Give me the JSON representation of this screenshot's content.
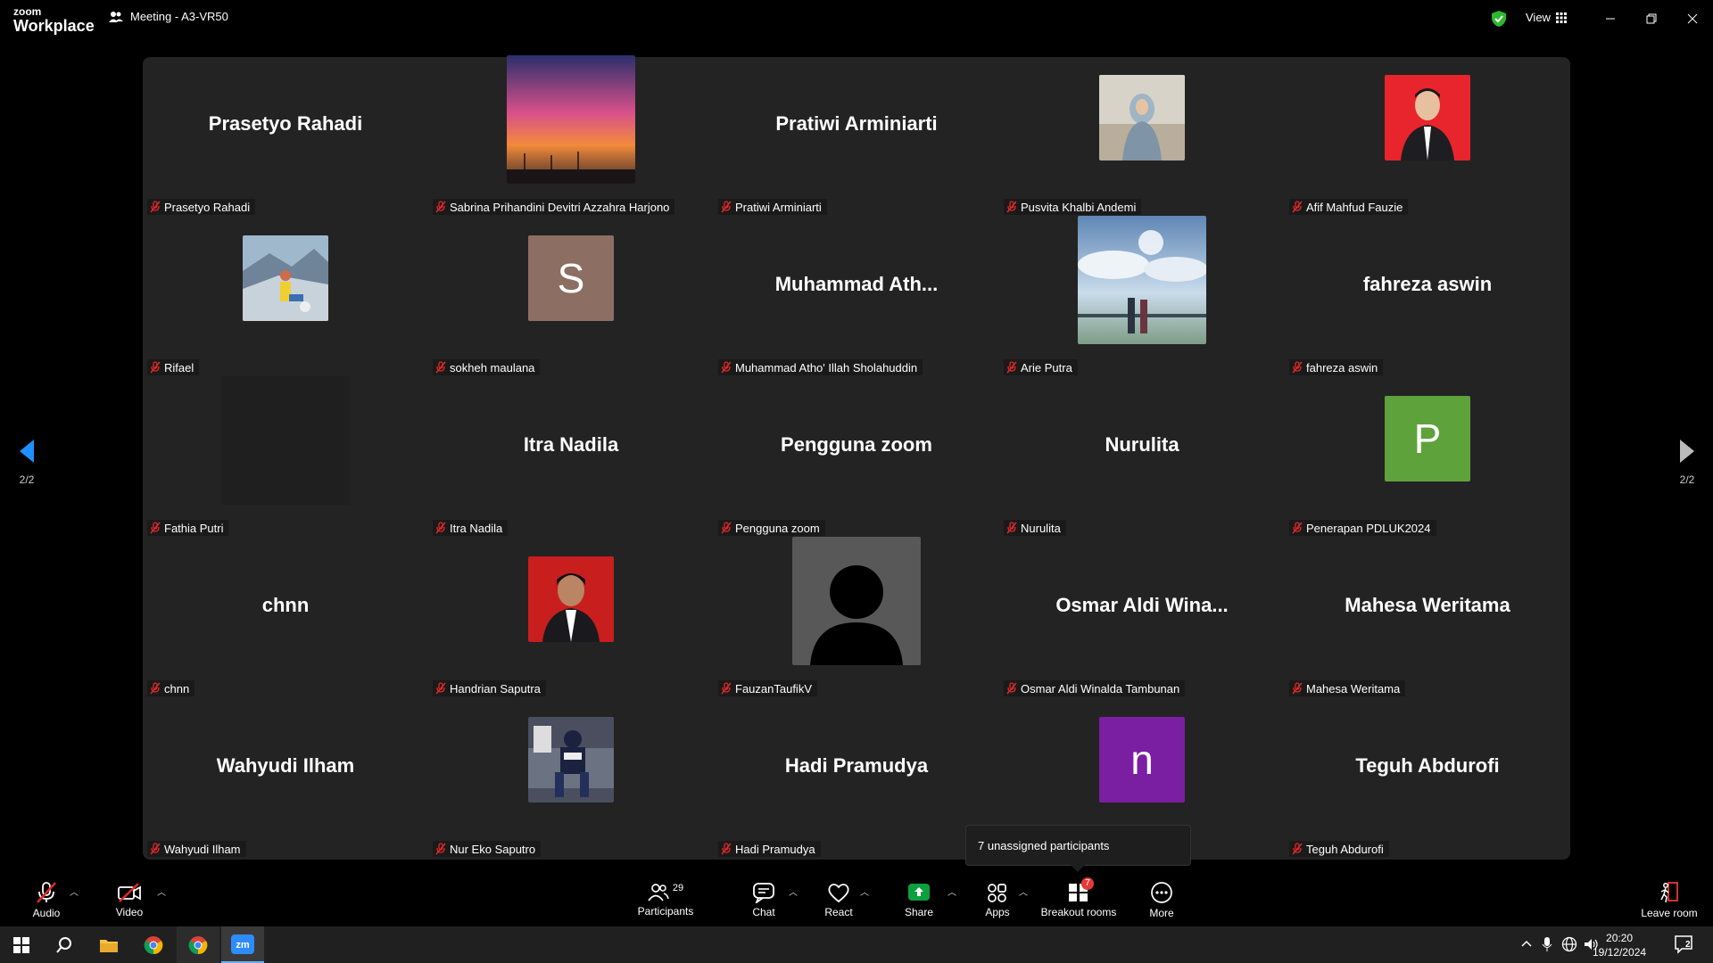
{
  "app": {
    "brand_top": "zoom",
    "brand_bottom": "Workplace",
    "meeting_title": "Meeting - A3-VR50",
    "view_label": "View"
  },
  "navigation": {
    "left_page": "2/2",
    "right_page": "2/2"
  },
  "participants_grid": [
    {
      "tile": "Prasetyo Rahadi",
      "caption": "Prasetyo Rahadi",
      "kind": "name"
    },
    {
      "tile": "",
      "caption": "Sabrina Prihandini Devitri Azzahra Harjono",
      "kind": "photo-sunset"
    },
    {
      "tile": "Pratiwi Arminiarti",
      "caption": "Pratiwi Arminiarti",
      "kind": "name"
    },
    {
      "tile": "",
      "caption": "Pusvita Khalbi Andemi",
      "kind": "photo-hijab"
    },
    {
      "tile": "",
      "caption": "Afif Mahfud Fauzie",
      "kind": "photo-red-formal"
    },
    {
      "tile": "",
      "caption": "Rifael",
      "kind": "photo-mountain"
    },
    {
      "tile": "S",
      "caption": "sokheh maulana",
      "kind": "letter",
      "color": "#8d6e63"
    },
    {
      "tile": "Muhammad  Ath...",
      "caption": "Muhammad Atho' Illah Sholahuddin",
      "kind": "name"
    },
    {
      "tile": "",
      "caption": "Arie Putra",
      "kind": "photo-sky"
    },
    {
      "tile": "fahreza aswin",
      "caption": "fahreza aswin",
      "kind": "name"
    },
    {
      "tile": "",
      "caption": "Fathia Putri",
      "kind": "dark"
    },
    {
      "tile": "Itra Nadila",
      "caption": "Itra Nadila",
      "kind": "name"
    },
    {
      "tile": "Pengguna zoom",
      "caption": "Pengguna zoom",
      "kind": "name"
    },
    {
      "tile": "Nurulita",
      "caption": "Nurulita",
      "kind": "name"
    },
    {
      "tile": "P",
      "caption": "Penerapan PDLUK2024",
      "kind": "letter",
      "color": "#5ea23c"
    },
    {
      "tile": "chnn",
      "caption": "chnn",
      "kind": "name"
    },
    {
      "tile": "",
      "caption": "Handrian Saputra",
      "kind": "photo-red-boy"
    },
    {
      "tile": "",
      "caption": "FauzanTaufikV",
      "kind": "silhouette"
    },
    {
      "tile": "Osmar  Aldi  Wina...",
      "caption": "Osmar Aldi Winalda Tambunan",
      "kind": "name"
    },
    {
      "tile": "Mahesa Weritama",
      "caption": "Mahesa Weritama",
      "kind": "name"
    },
    {
      "tile": "Wahyudi Ilham",
      "caption": "Wahyudi Ilham",
      "kind": "name"
    },
    {
      "tile": "",
      "caption": "Nur Eko Saputro",
      "kind": "photo-sofa"
    },
    {
      "tile": "Hadi Pramudya",
      "caption": "Hadi Pramudya",
      "kind": "name"
    },
    {
      "tile": "n",
      "caption": "",
      "kind": "letter",
      "color": "#7b1fa2"
    },
    {
      "tile": "Teguh Abdurofi",
      "caption": "Teguh Abdurofi",
      "kind": "name"
    }
  ],
  "tooltip": {
    "text": "7 unassigned participants"
  },
  "toolbar": {
    "audio": "Audio",
    "video": "Video",
    "participants": "Participants",
    "participants_count": "29",
    "chat": "Chat",
    "react": "React",
    "share": "Share",
    "apps": "Apps",
    "breakout": "Breakout rooms",
    "breakout_badge": "7",
    "more": "More",
    "leave": "Leave room"
  },
  "taskbar": {
    "time": "20:20",
    "date": "19/12/2024",
    "notifications": "2"
  },
  "colors": {
    "muted_red": "#e02828",
    "share_green": "#0e9f3e",
    "accent_blue": "#1e90ff",
    "badge_red": "#e53935"
  }
}
